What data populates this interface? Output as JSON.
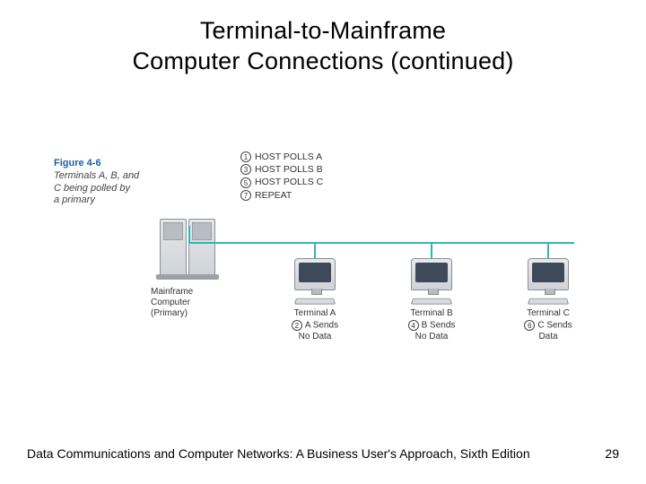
{
  "title_line1": "Terminal-to-Mainframe",
  "title_line2": "Computer Connections (continued)",
  "figure": {
    "number": "Figure 4-6",
    "caption_l1": "Terminals A, B, and",
    "caption_l2": "C being polled by",
    "caption_l3": "a primary"
  },
  "poll": {
    "p1": {
      "n": "1",
      "t": "HOST POLLS  A"
    },
    "p2": {
      "n": "3",
      "t": "HOST POLLS  B"
    },
    "p3": {
      "n": "5",
      "t": "HOST POLLS  C"
    },
    "p4": {
      "n": "7",
      "t": "REPEAT"
    }
  },
  "mainframe": {
    "l1": "Mainframe",
    "l2": "Computer",
    "l3": "(Primary)"
  },
  "terminals": {
    "a": {
      "name": "Terminal A",
      "noteN": "2",
      "note1": "A Sends",
      "note2": "No Data"
    },
    "b": {
      "name": "Terminal B",
      "noteN": "4",
      "note1": "B Sends",
      "note2": "No Data"
    },
    "c": {
      "name": "Terminal C",
      "noteN": "6",
      "note1": "C Sends",
      "note2": "Data"
    }
  },
  "footer": {
    "text": "Data Communications and Computer Networks: A Business User's Approach, Sixth Edition",
    "page": "29"
  }
}
